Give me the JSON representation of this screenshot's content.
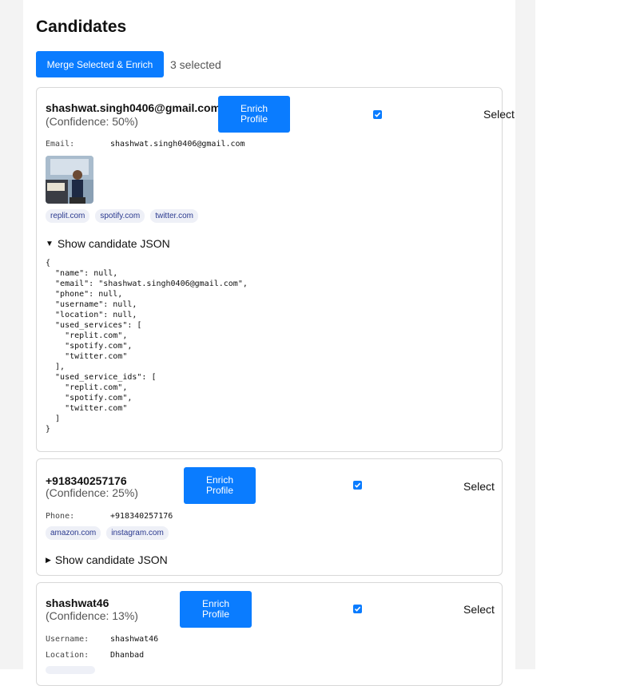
{
  "page": {
    "title": "Candidates",
    "merge_button_label": "Merge Selected & Enrich",
    "selected_count": "3 selected"
  },
  "candidates": [
    {
      "name": "shashwat.singh0406@gmail.com",
      "confidence": "(Confidence: 50%)",
      "enrich_label": "Enrich Profile",
      "select_label": "Select",
      "selected": true,
      "fields": [
        {
          "label": "Email:",
          "value": "shashwat.singh0406@gmail.com"
        }
      ],
      "services": [
        "replit.com",
        "spotify.com",
        "twitter.com"
      ],
      "json_toggle": "Show candidate JSON",
      "json_expanded": true,
      "json_text": "{\n  \"name\": null,\n  \"email\": \"shashwat.singh0406@gmail.com\",\n  \"phone\": null,\n  \"username\": null,\n  \"location\": null,\n  \"used_services\": [\n    \"replit.com\",\n    \"spotify.com\",\n    \"twitter.com\"\n  ],\n  \"used_service_ids\": [\n    \"replit.com\",\n    \"spotify.com\",\n    \"twitter.com\"\n  ]\n}"
    },
    {
      "name": "+918340257176",
      "confidence": "(Confidence: 25%)",
      "enrich_label": "Enrich Profile",
      "select_label": "Select",
      "selected": true,
      "fields": [
        {
          "label": "Phone:",
          "value": "+918340257176"
        }
      ],
      "services": [
        "amazon.com",
        "instagram.com"
      ],
      "json_toggle": "Show candidate JSON",
      "json_expanded": false
    },
    {
      "name": "shashwat46",
      "confidence": "(Confidence: 13%)",
      "enrich_label": "Enrich Profile",
      "select_label": "Select",
      "selected": true,
      "fields": [
        {
          "label": "Username:",
          "value": "shashwat46"
        },
        {
          "label": "Location:",
          "value": "Dhanbad"
        }
      ]
    }
  ],
  "colors": {
    "accent": "#0a7cff",
    "tag_bg": "#eef0f7",
    "tag_text": "#2b3a8f",
    "page_bg": "#f3f3f3"
  }
}
